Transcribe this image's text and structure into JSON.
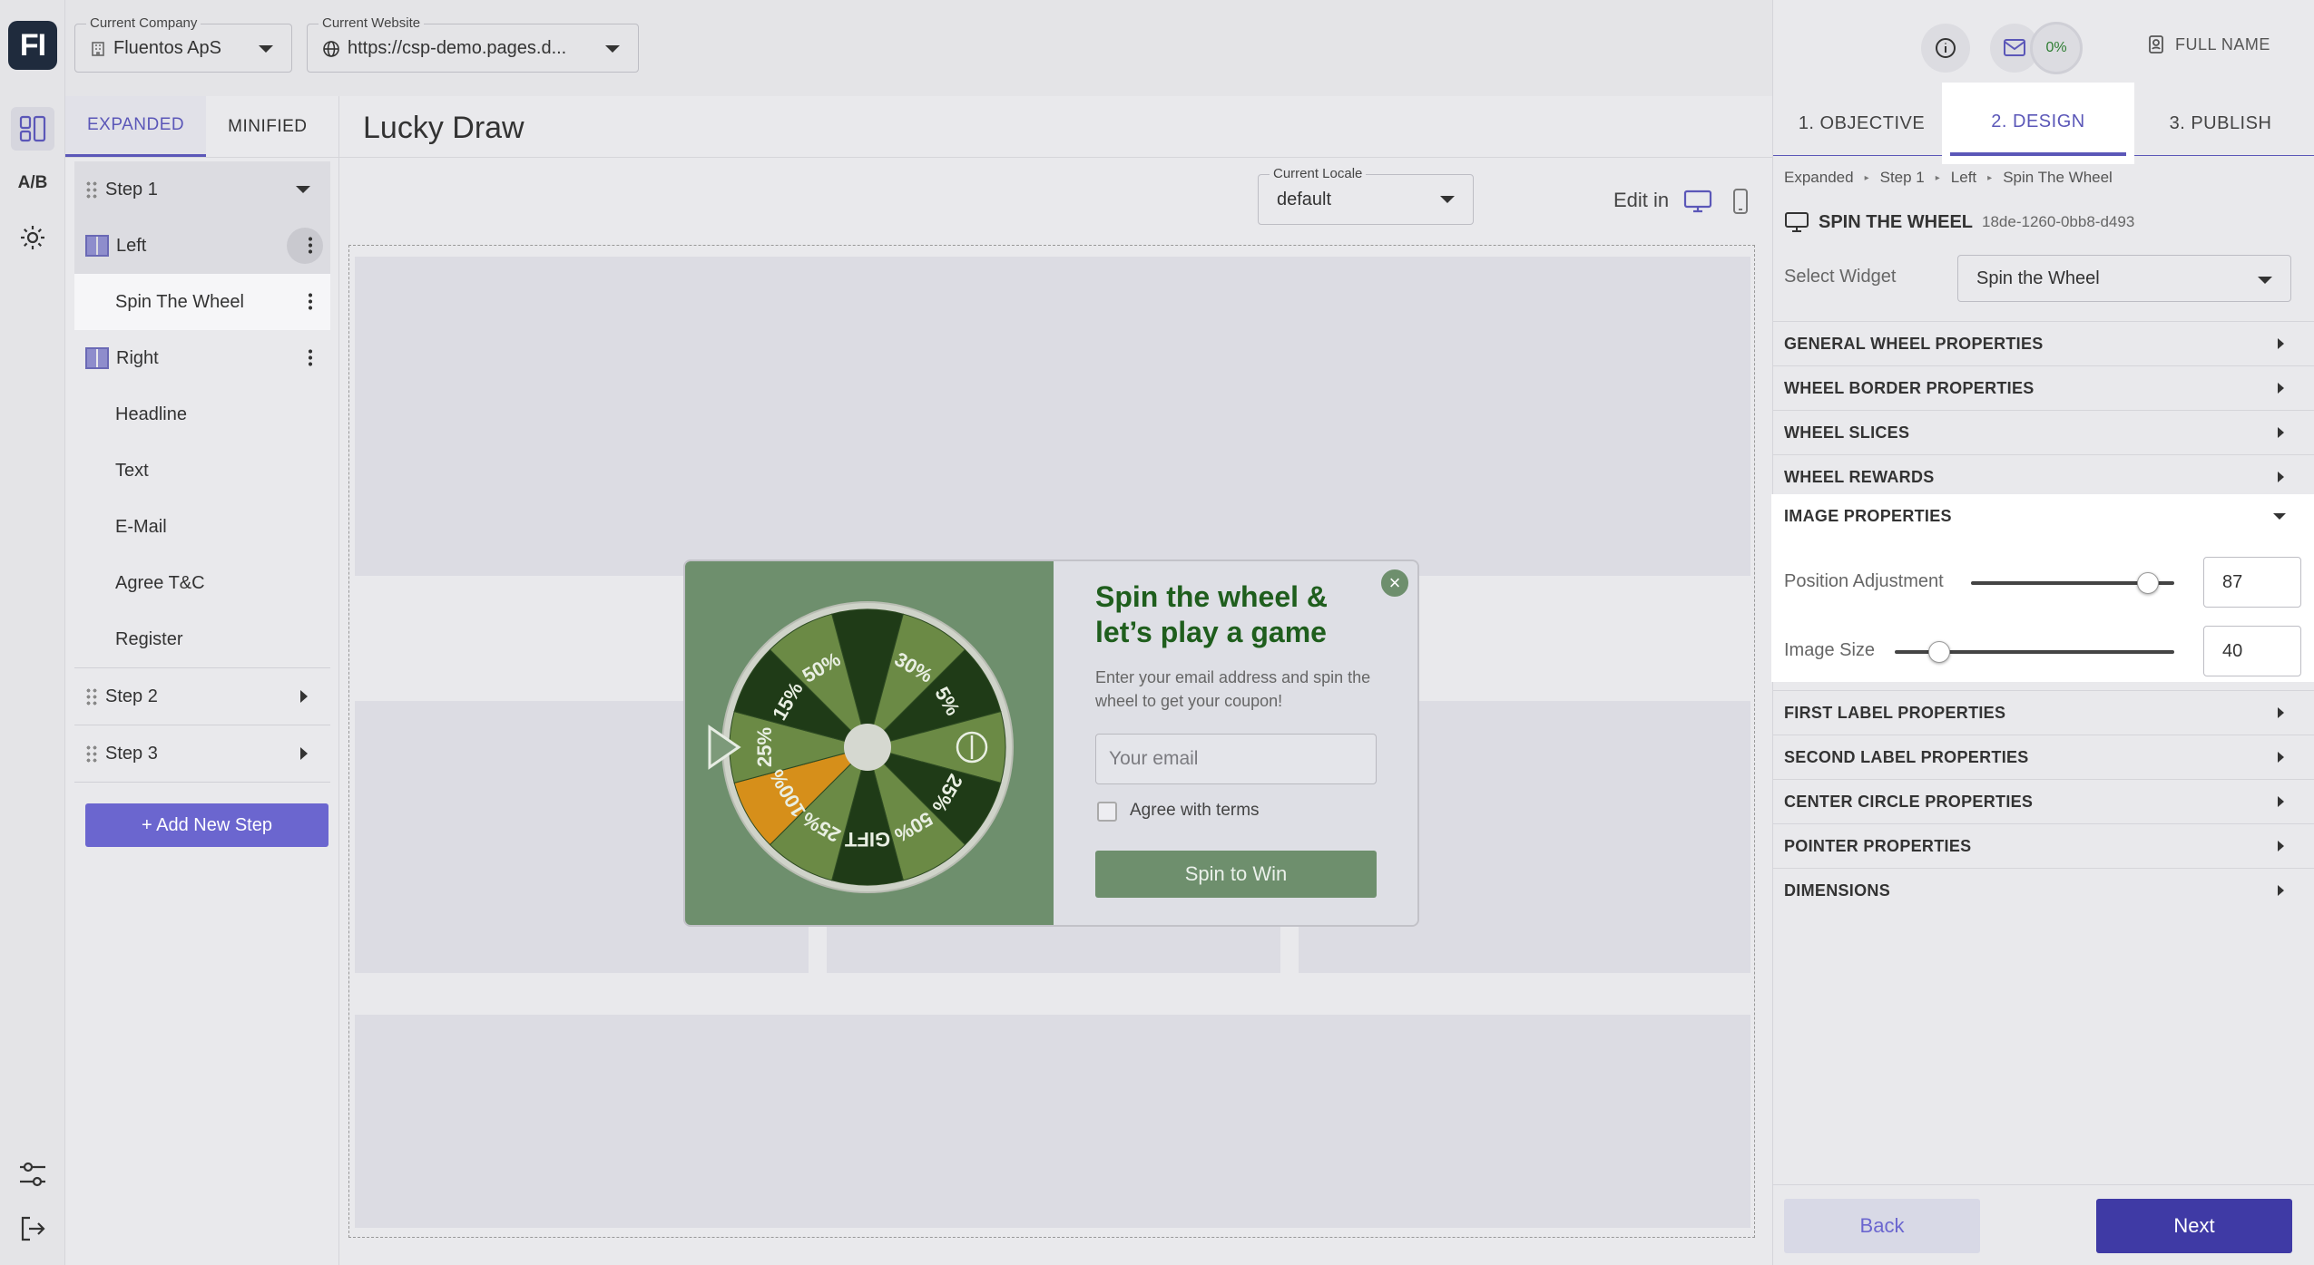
{
  "app": {
    "logo_text": "FI"
  },
  "rail": {
    "ab_label": "A/B"
  },
  "topbar": {
    "company": {
      "label": "Current Company",
      "value": "Fluentos ApS"
    },
    "website": {
      "label": "Current Website",
      "value": "https://csp-demo.pages.d..."
    }
  },
  "steps_panel": {
    "tabs": [
      "EXPANDED",
      "MINIFIED"
    ],
    "items": [
      {
        "label": "Step 1",
        "kind": "step"
      },
      {
        "label": "Left",
        "kind": "column"
      },
      {
        "label": "Spin The Wheel",
        "kind": "widget"
      },
      {
        "label": "Right",
        "kind": "column"
      },
      {
        "label": "Headline",
        "kind": "widget"
      },
      {
        "label": "Text",
        "kind": "widget"
      },
      {
        "label": "E-Mail",
        "kind": "widget"
      },
      {
        "label": "Agree T&C",
        "kind": "widget"
      },
      {
        "label": "Register",
        "kind": "widget"
      },
      {
        "label": "Step 2",
        "kind": "step"
      },
      {
        "label": "Step 3",
        "kind": "step"
      }
    ],
    "add_step": "+ Add New Step"
  },
  "canvas": {
    "title": "Lucky Draw",
    "locale": {
      "label": "Current Locale",
      "value": "default"
    },
    "edit_in": "Edit in"
  },
  "popup": {
    "title": "Spin the wheel & let’s play a game",
    "description": "Enter your email address and spin the wheel to get your coupon!",
    "email_placeholder": "Your email",
    "agree": "Agree with terms",
    "button": "Spin to Win",
    "wheel_slices": [
      "30%",
      "5%",
      "",
      "25%",
      "50%",
      "GIFT",
      "25%",
      "100%",
      "25%",
      "15%",
      "50%"
    ],
    "colors": {
      "wheel_dark": "#1f3b17",
      "wheel_light": "#6b8a45",
      "wheel_accent": "#d68f1a",
      "panel": "#6e8f6d",
      "title": "#1f5e1d"
    }
  },
  "right_panel": {
    "progress": "0%",
    "user": "FULL NAME",
    "tabs": [
      "1. OBJECTIVE",
      "2. DESIGN",
      "3. PUBLISH"
    ],
    "breadcrumb": [
      "Expanded",
      "Step 1",
      "Left",
      "Spin The Wheel"
    ],
    "widget_title": "SPIN THE WHEEL",
    "widget_id": "18de-1260-0bb8-d493",
    "select_widget": {
      "label": "Select Widget",
      "value": "Spin the Wheel"
    },
    "sections": [
      "GENERAL WHEEL PROPERTIES",
      "WHEEL BORDER PROPERTIES",
      "WHEEL SLICES",
      "WHEEL REWARDS",
      "IMAGE PROPERTIES",
      "FIRST LABEL PROPERTIES",
      "SECOND LABEL PROPERTIES",
      "CENTER CIRCLE PROPERTIES",
      "POINTER PROPERTIES",
      "DIMENSIONS"
    ],
    "image_properties": {
      "position_label": "Position Adjustment",
      "position_value": "87",
      "position_fraction": 0.87,
      "size_label": "Image Size",
      "size_value": "40",
      "size_fraction": 0.16
    },
    "back": "Back",
    "next": "Next",
    "accent": "#5b57b8"
  }
}
